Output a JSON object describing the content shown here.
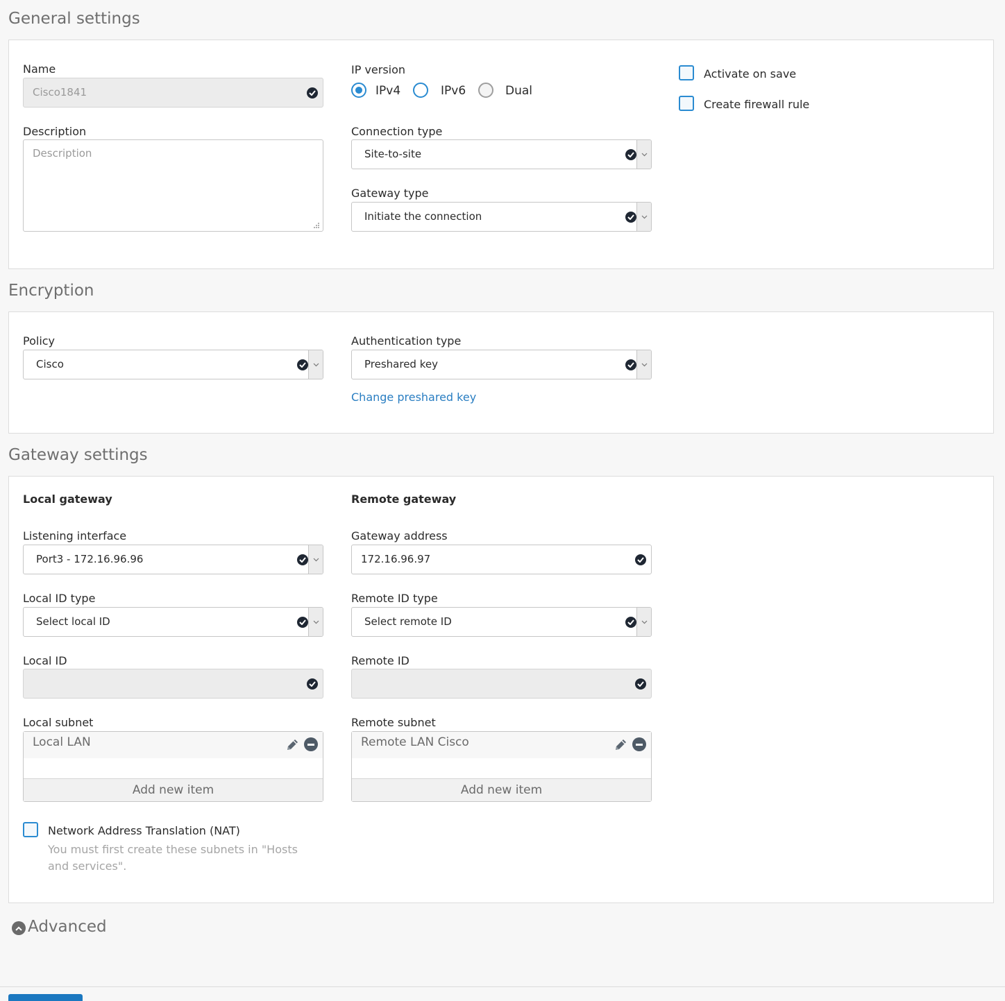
{
  "sections": {
    "general": "General settings",
    "encryption": "Encryption",
    "gateway": "Gateway settings",
    "advanced": "Advanced"
  },
  "general": {
    "name_label": "Name",
    "name_value": "Cisco1841",
    "description_label": "Description",
    "description_placeholder": "Description",
    "ip_version_label": "IP version",
    "ip_options": [
      "IPv4",
      "IPv6",
      "Dual"
    ],
    "ip_selected": "IPv4",
    "connection_type_label": "Connection type",
    "connection_type_value": "Site-to-site",
    "gateway_type_label": "Gateway type",
    "gateway_type_value": "Initiate the connection",
    "activate_on_save": "Activate on save",
    "create_firewall_rule": "Create firewall rule"
  },
  "encryption": {
    "policy_label": "Policy",
    "policy_value": "Cisco",
    "auth_type_label": "Authentication type",
    "auth_type_value": "Preshared key",
    "change_key_link": "Change preshared key"
  },
  "gateway": {
    "local_heading": "Local gateway",
    "remote_heading": "Remote gateway",
    "listening_interface_label": "Listening interface",
    "listening_interface_value": "Port3 - 172.16.96.96",
    "gateway_address_label": "Gateway address",
    "gateway_address_value": "172.16.96.97",
    "local_id_type_label": "Local ID type",
    "local_id_type_value": "Select local ID",
    "remote_id_type_label": "Remote ID type",
    "remote_id_type_value": "Select remote ID",
    "local_id_label": "Local ID",
    "remote_id_label": "Remote ID",
    "local_subnet_label": "Local subnet",
    "local_subnet_item": "Local LAN",
    "remote_subnet_label": "Remote subnet",
    "remote_subnet_item": "Remote LAN Cisco",
    "add_new_item": "Add new item",
    "nat_label": "Network Address Translation (NAT)",
    "nat_hint": "You must first create these subnets in \"Hosts and services\"."
  },
  "colors": {
    "accent": "#2a8bd1",
    "link": "#2a7ec2",
    "check_icon_bg": "#1f2733",
    "button": "#1b78c0"
  }
}
